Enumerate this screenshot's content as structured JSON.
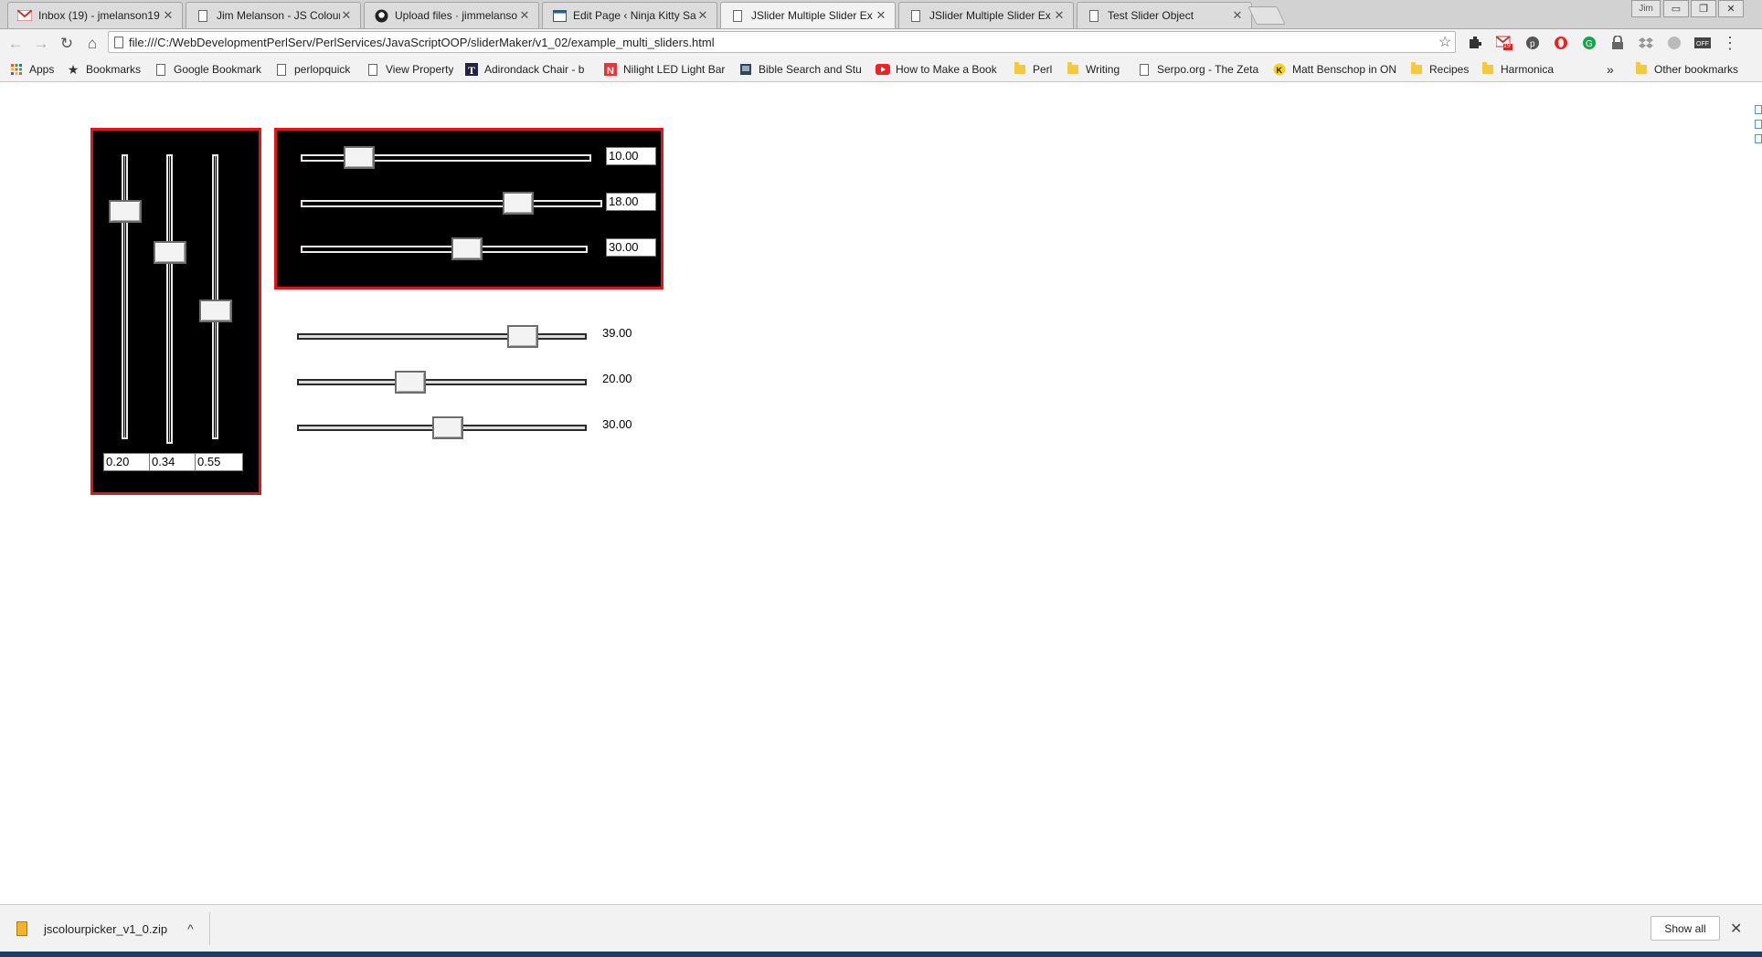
{
  "tabs": [
    {
      "label": "Inbox (19) - jmelanson19",
      "icon": "gmail-icon",
      "active": false
    },
    {
      "label": "Jim Melanson - JS Colour",
      "icon": "page-icon",
      "active": false
    },
    {
      "label": "Upload files · jimmelanso",
      "icon": "github-icon",
      "active": false
    },
    {
      "label": "Edit Page ‹ Ninja Kitty Sa",
      "icon": "wordpress-icon",
      "active": false
    },
    {
      "label": "JSlider Multiple Slider Ex",
      "icon": "page-icon",
      "active": true
    },
    {
      "label": "JSlider Multiple Slider Ex",
      "icon": "page-icon",
      "active": false
    },
    {
      "label": "Test Slider Object",
      "icon": "page-icon",
      "active": false
    }
  ],
  "window": {
    "user": "Jim",
    "minimize": "▭",
    "restore": "❐",
    "close": "✕"
  },
  "toolbar": {
    "back": "←",
    "forward": "→",
    "reload": "↻",
    "home": "⌂",
    "url": "file:///C:/WebDevelopmentPerlServ/PerlServices/JavaScriptOOP/sliderMaker/v1_02/example_multi_sliders.html",
    "star": "☆",
    "gmail_badge": "19",
    "menu": "⋮"
  },
  "bookmarks": [
    {
      "label": "Apps",
      "icon": "apps-icon"
    },
    {
      "label": "Bookmarks",
      "icon": "star-icon"
    },
    {
      "label": "Google Bookmark",
      "icon": "page-icon"
    },
    {
      "label": "perlopquick",
      "icon": "page-icon"
    },
    {
      "label": "View Property",
      "icon": "page-icon"
    },
    {
      "label": "Adirondack Chair - b",
      "icon": "t-icon"
    },
    {
      "label": "Nilight LED Light Bar",
      "icon": "n-icon"
    },
    {
      "label": "Bible Search and Stu",
      "icon": "book-icon"
    },
    {
      "label": "How to Make a Book",
      "icon": "youtube-icon"
    },
    {
      "label": "Perl",
      "icon": "folder-icon"
    },
    {
      "label": "Writing",
      "icon": "folder-icon"
    },
    {
      "label": "Serpo.org - The Zeta",
      "icon": "page-icon"
    },
    {
      "label": "Matt Benschop in ON",
      "icon": "k-icon"
    },
    {
      "label": "Recipes",
      "icon": "folder-icon"
    },
    {
      "label": "Harmonica",
      "icon": "folder-icon"
    }
  ],
  "bookmarks_overflow": "»",
  "other_bookmarks": "Other bookmarks",
  "vertical_sliders": {
    "values": [
      "0.20",
      "0.34",
      "0.55"
    ],
    "levels": [
      0.8,
      0.66,
      0.45
    ]
  },
  "horizontal_sliders_boxed": {
    "values": [
      "10.00",
      "18.00",
      "30.00"
    ],
    "levels": [
      0.2,
      0.72,
      0.58
    ]
  },
  "horizontal_sliders_plain": {
    "values": [
      "39.00",
      "20.00",
      "30.00"
    ],
    "levels": [
      0.78,
      0.39,
      0.52
    ]
  },
  "downloads": {
    "file": "jscolourpicker_v1_0.zip",
    "chevron": "^",
    "show_all": "Show all",
    "close": "✕"
  },
  "colors": {
    "panel_border": "#e0141b",
    "panel_bg": "#000000"
  }
}
